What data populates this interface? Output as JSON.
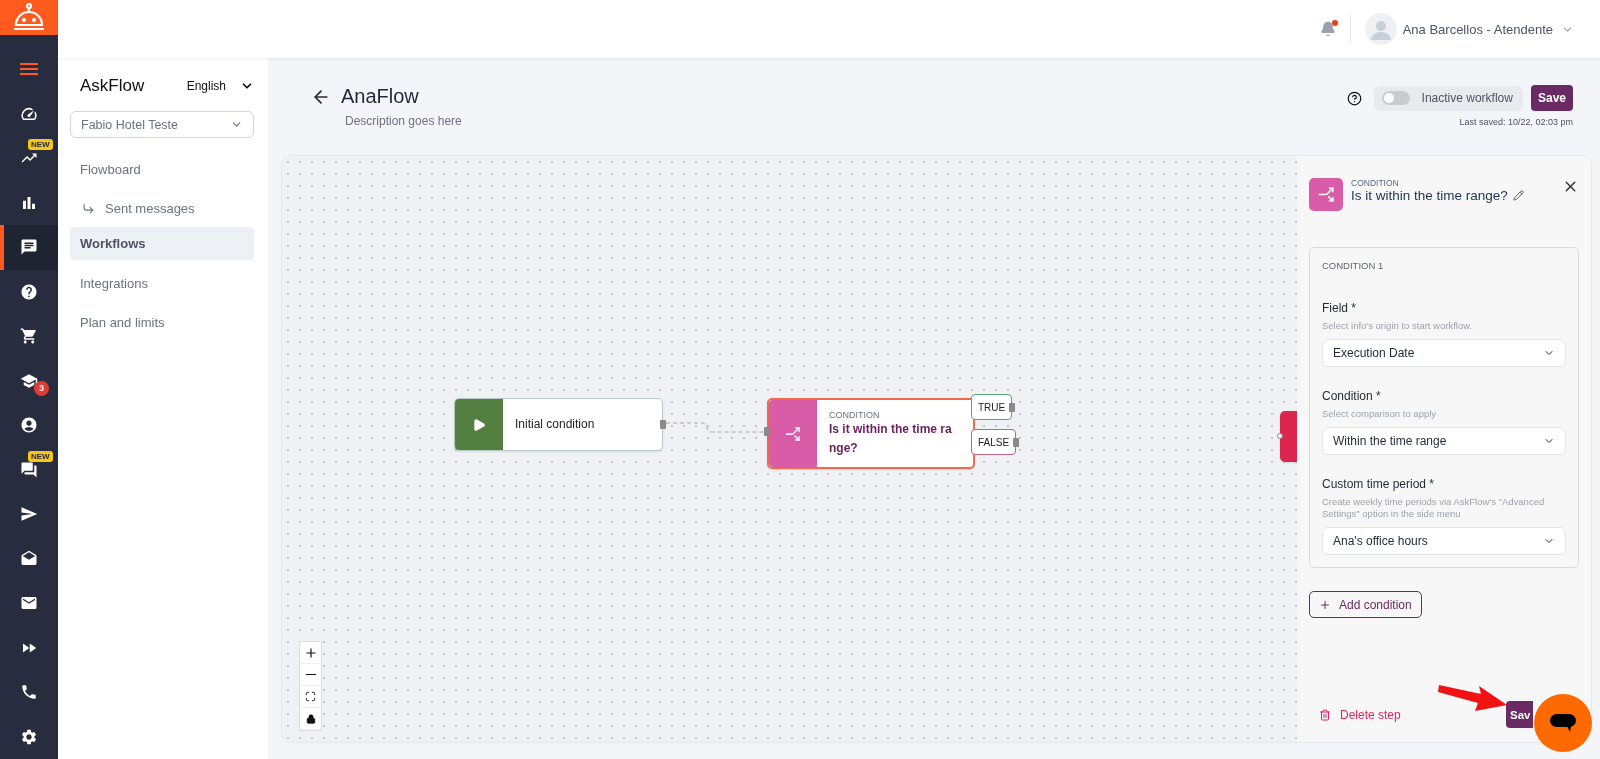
{
  "rail": {
    "items": [
      {
        "selected": false
      },
      {
        "selected": false
      },
      {
        "selected": false,
        "badge": {
          "kind": "new",
          "text": "NEW"
        }
      },
      {
        "selected": false
      },
      {
        "selected": true
      },
      {
        "selected": false
      },
      {
        "selected": false
      },
      {
        "selected": false,
        "badge": {
          "kind": "count",
          "text": "3"
        }
      },
      {
        "selected": false
      },
      {
        "selected": false,
        "badge": {
          "kind": "new",
          "text": "NEW"
        }
      },
      {
        "selected": false
      },
      {
        "selected": false
      },
      {
        "selected": false
      },
      {
        "selected": false
      },
      {
        "selected": false
      },
      {
        "selected": false
      }
    ]
  },
  "topbar": {
    "unread": true,
    "user": "Ana Barcellos - Atendente"
  },
  "sidebar": {
    "title": "AskFlow",
    "language": "English",
    "account": "Fabio Hotel Teste",
    "items": [
      {
        "kind": "item",
        "label": "Flowboard",
        "selected": false
      },
      {
        "kind": "subitem",
        "label": "Sent messages",
        "selected": false
      },
      {
        "kind": "item",
        "label": "Workflows",
        "selected": true
      },
      {
        "kind": "item",
        "label": "Integrations",
        "selected": false
      },
      {
        "kind": "item",
        "label": "Plan and limits",
        "selected": false
      }
    ]
  },
  "header": {
    "title": "AnaFlow",
    "description": "Description goes here",
    "toggle": {
      "label": "Inactive workflow",
      "on": false
    },
    "save": "Save",
    "last_saved": "Last saved: 10/22, 02:03 pm"
  },
  "canvas": {
    "nodes": [
      {
        "kind": "start",
        "title": "Initial condition",
        "selected": false
      },
      {
        "kind": "condition",
        "label": "CONDITION",
        "title": "Is it within the time range?",
        "selected": true,
        "outputs": [
          {
            "kind": "true",
            "label": "TRUE"
          },
          {
            "kind": "false",
            "label": "FALSE"
          }
        ]
      },
      {
        "kind": "action"
      }
    ]
  },
  "panel": {
    "type_label": "CONDITION",
    "title": "Is it within the time range?",
    "group": {
      "title": "CONDITION 1",
      "fields": [
        {
          "label": "Field *",
          "hint": "Select info's origin to start workflow.",
          "value": "Execution Date"
        },
        {
          "label": "Condition *",
          "hint": "Select comparison to apply",
          "value": "Within the time range"
        },
        {
          "label": "Custom time period *",
          "hint": "Create weekly time periods via AskFlow's \"Advanced Settings\" option in the side menu",
          "value": "Ana's office hours"
        }
      ]
    },
    "add_button": "Add condition",
    "delete_button": "Delete step",
    "save_button": "Sav"
  }
}
